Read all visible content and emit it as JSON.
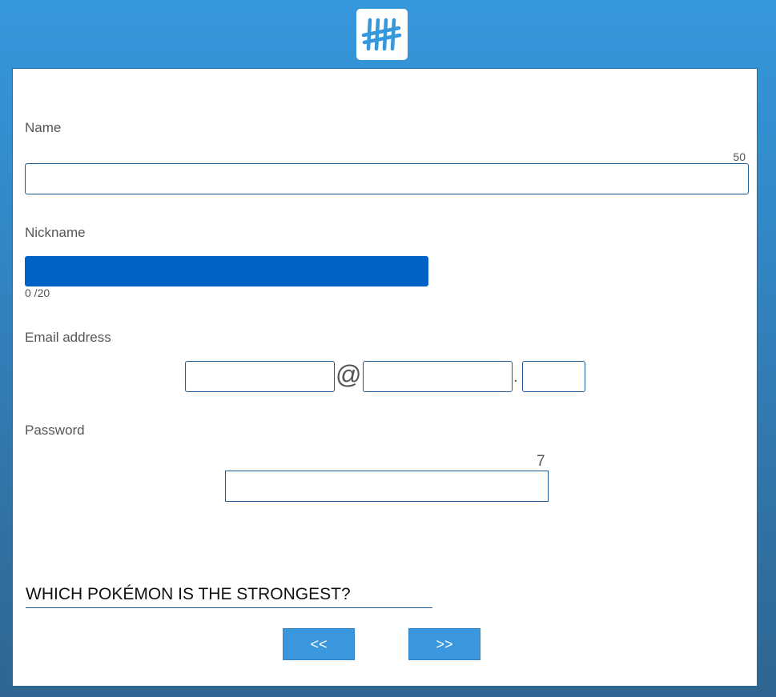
{
  "header": {
    "logo_icon": "tally-marks-icon",
    "logo_color": "#3598dc"
  },
  "form": {
    "name": {
      "label": "Name",
      "value": "",
      "char_limit": "50"
    },
    "nickname": {
      "label": "Nickname",
      "value": "",
      "counter": "0 /20"
    },
    "email": {
      "label": "Email address",
      "user": "",
      "at_symbol": "@",
      "domain": "",
      "dot_symbol": ".",
      "tld": ""
    },
    "password": {
      "label": "Password",
      "value": "",
      "char_counter": "7"
    },
    "question": {
      "text": "WHICH POKÉMON IS THE STRONGEST?"
    }
  },
  "navigation": {
    "prev_label": "<<",
    "next_label": ">>",
    "button_color": "#3a96dd"
  }
}
